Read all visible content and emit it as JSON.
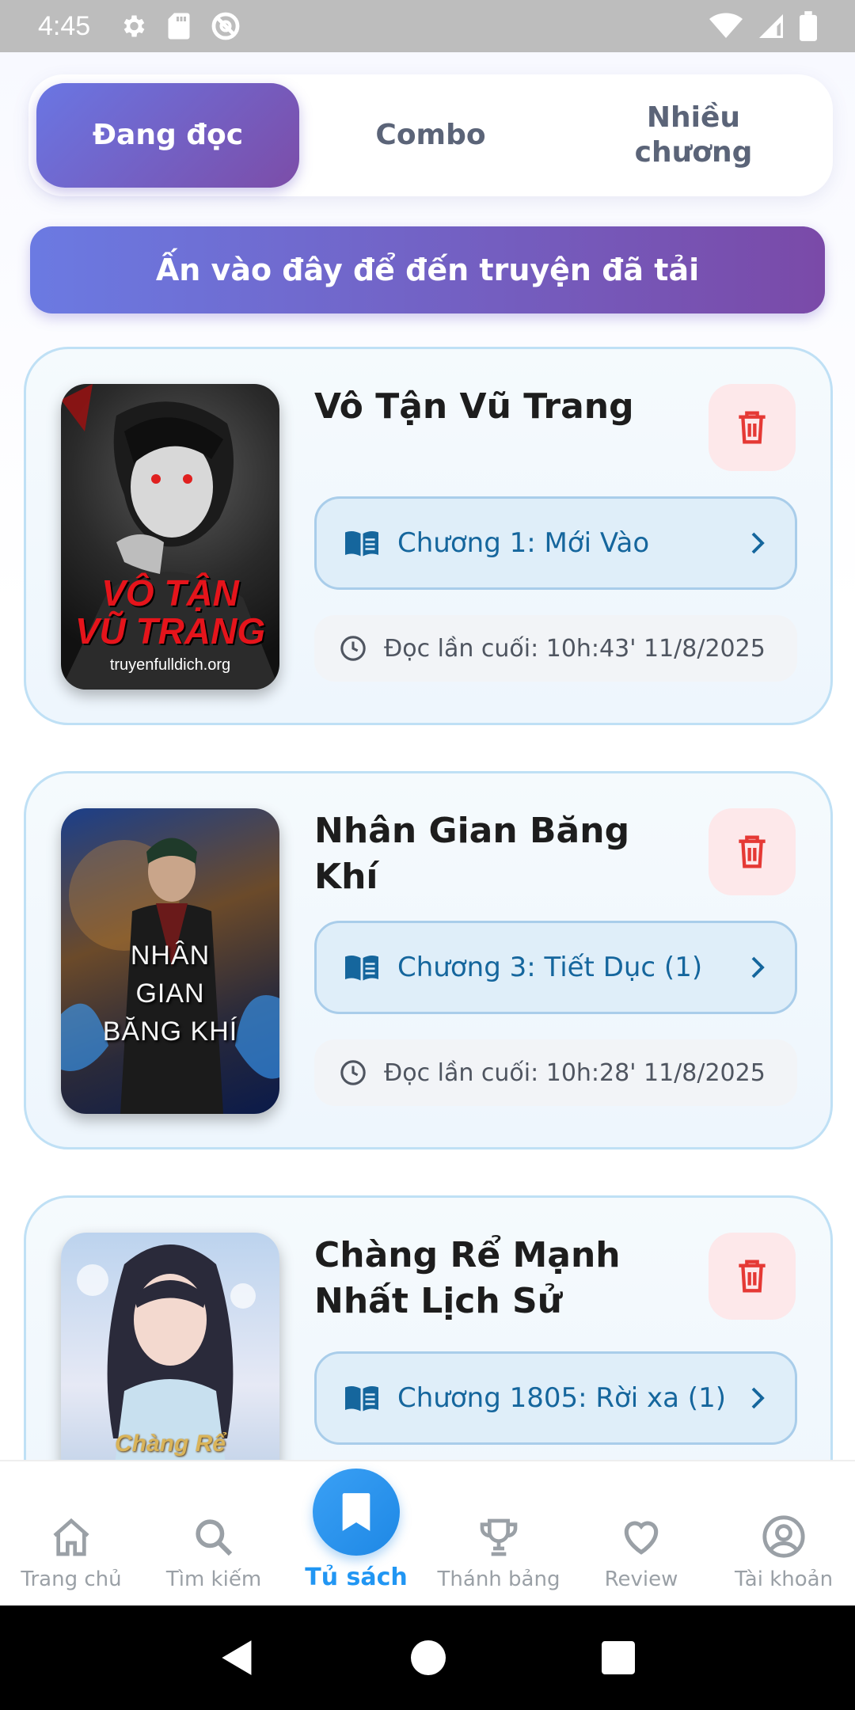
{
  "status_bar": {
    "time": "4:45",
    "icons": [
      "gear-icon",
      "sd-card-icon",
      "at-sign-icon",
      "wifi-icon",
      "signal-icon",
      "battery-icon"
    ]
  },
  "tabs": [
    {
      "label": "Đang đọc",
      "active": true
    },
    {
      "label": "Combo",
      "active": false
    },
    {
      "label": "Nhiều\nchương",
      "active": false
    }
  ],
  "downloaded_button": "Ấn vào đây để đến truyện đã tải",
  "books": [
    {
      "title": "Vô Tận Vũ Trang",
      "cover_title": "VÔ TẬN\nVŨ TRANG",
      "cover_site": "truyenfulldich.org",
      "chapter": "Chương 1:  Mới Vào",
      "last_read": "Đọc lần cuối: 10h:43' 11/8/2025"
    },
    {
      "title": "Nhân Gian Băng Khí",
      "cover_title": "NHÂN\nGIAN\nBĂNG KHÍ",
      "chapter": "Chương 3:   Tiết Dục (1)",
      "last_read": "Đọc lần cuối: 10h:28' 11/8/2025"
    },
    {
      "title": "Chàng Rể Mạnh Nhất Lịch Sử",
      "cover_title": "Chàng Rể",
      "chapter": "Chương 1805:   Rời xa (1)"
    }
  ],
  "bottom_nav": [
    {
      "label": "Trang chủ",
      "icon": "home-icon",
      "active": false
    },
    {
      "label": "Tìm kiếm",
      "icon": "search-icon",
      "active": false
    },
    {
      "label": "Tủ sách",
      "icon": "bookmark-icon",
      "active": true
    },
    {
      "label": "Thánh bảng",
      "icon": "trophy-icon",
      "active": false
    },
    {
      "label": "Review",
      "icon": "heart-icon",
      "active": false
    },
    {
      "label": "Tài khoản",
      "icon": "account-icon",
      "active": false
    }
  ],
  "colors": {
    "accent_gradient_start": "#6a76e3",
    "accent_gradient_end": "#7c4da8",
    "chapter_text": "#15669d",
    "delete_icon": "#e53935",
    "nav_active": "#2196f3"
  }
}
